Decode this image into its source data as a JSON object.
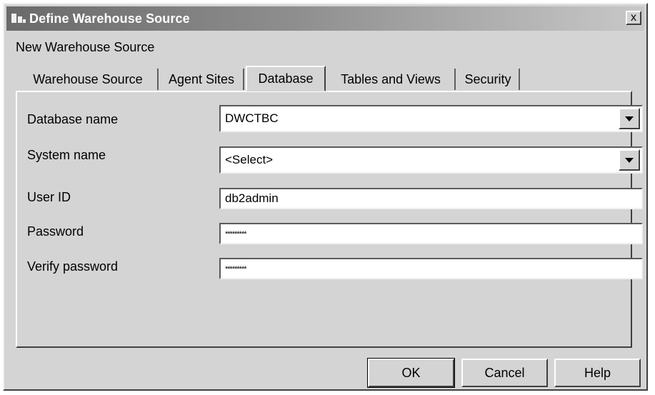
{
  "window": {
    "title": "Define Warehouse Source",
    "close_glyph": "x"
  },
  "subtitle": "New Warehouse Source",
  "tabs": [
    {
      "label": "Warehouse Source",
      "active": false
    },
    {
      "label": "Agent Sites",
      "active": false
    },
    {
      "label": "Database",
      "active": true
    },
    {
      "label": "Tables and Views",
      "active": false
    },
    {
      "label": "Security",
      "active": false
    }
  ],
  "form": {
    "database_name": {
      "label": "Database name",
      "value": "DWCTBC"
    },
    "system_name": {
      "label": "System name",
      "value": "<Select>"
    },
    "user_id": {
      "label": "User ID",
      "value": "db2admin"
    },
    "password": {
      "label": "Password",
      "value": "*********"
    },
    "verify_password": {
      "label": "Verify password",
      "value": "*********"
    }
  },
  "buttons": {
    "ok": "OK",
    "cancel": "Cancel",
    "help": "Help"
  },
  "icons": {
    "app": "warehouse-app-icon",
    "close": "close-icon",
    "dropdown": "chevron-down-icon"
  }
}
